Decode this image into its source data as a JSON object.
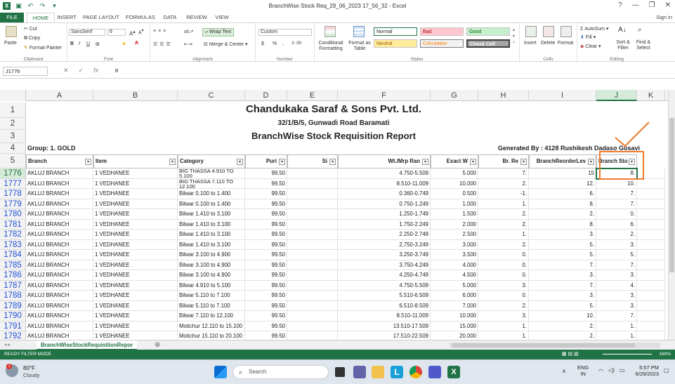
{
  "window": {
    "title": "BranchWise Stock Req_29_06_2023 17_56_32 - Excel",
    "help": "?",
    "minimize": "—",
    "restore": "❐",
    "close": "✕"
  },
  "tabs": [
    "FILE",
    "HOME",
    "INSERT",
    "PAGE LAYOUT",
    "FORMULAS",
    "DATA",
    "REVIEW",
    "VIEW"
  ],
  "signin": "Sign in",
  "ribbon": {
    "clipboard": {
      "paste": "Paste",
      "cut": "Cut",
      "copy": "Copy",
      "format_painter": "Format Painter",
      "label": "Clipboard"
    },
    "font": {
      "name": "SansSerif",
      "size": "6",
      "bold": "B",
      "italic": "I",
      "underline": "U",
      "label": "Font"
    },
    "alignment": {
      "wrap": "Wrap Text",
      "merge": "Merge & Center",
      "label": "Alignment"
    },
    "number": {
      "format": "Custom",
      "currency": "$",
      "percent": "%",
      "comma": ",",
      "label": "Number"
    },
    "styles": {
      "conditional": "Conditional Formatting",
      "format_table": "Format as Table",
      "normal": "Normal",
      "bad": "Bad",
      "good": "Good",
      "neutral": "Neutral",
      "calculation": "Calculation",
      "check_cell": "Check Cell",
      "label": "Styles"
    },
    "cells": {
      "insert": "Insert",
      "delete": "Delete",
      "format": "Format",
      "label": "Cells"
    },
    "editing": {
      "autosum": "AutoSum",
      "fill": "Fill",
      "clear": "Clear",
      "sort": "Sort & Filter",
      "find": "Find & Select",
      "label": "Editing"
    }
  },
  "formula_bar": {
    "name_box": "J1776",
    "fx": "fx",
    "cancel": "✕",
    "enter": "✓",
    "value": "8"
  },
  "columns": [
    "A",
    "B",
    "C",
    "D",
    "E",
    "F",
    "G",
    "H",
    "I",
    "J",
    "K"
  ],
  "report": {
    "company": "Chandukaka Saraf & Sons Pvt. Ltd.",
    "address": "32/1/B/5, Gunwadi Road Baramati",
    "report_title": "BranchWise Stock Requisition Report",
    "group": "Group: 1. GOLD",
    "generated_by": "Generated By : 4128 Rushikesh Dadaso Gosavi"
  },
  "headers": [
    "Branch",
    "Item",
    "Category",
    "Puri",
    "Si",
    "Wt./Mrp Ran",
    "Exact W",
    "Br. Re",
    "BranchReorderLev",
    "Branch Sto"
  ],
  "header_rows": [
    "1",
    "2",
    "3",
    "4",
    "5"
  ],
  "rows": [
    {
      "n": "1776",
      "branch": "AKLUJ BRANCH",
      "item": "1 VEDHANEE",
      "category": "BIG THASSA 4.910 TO 5.100",
      "purity": "99.50",
      "wt": "4.750-5.509",
      "exact": "5.000",
      "br": "7.",
      "reorder": "15",
      "stock": "8."
    },
    {
      "n": "1777",
      "branch": "AKLUJ BRANCH",
      "item": "1 VEDHANEE",
      "category": "BIG THASSA 7.110 TO 12.100",
      "purity": "99.50",
      "wt": "8.510-11.009",
      "exact": "10.000",
      "br": "2.",
      "reorder": "12.",
      "stock": "10."
    },
    {
      "n": "1778",
      "branch": "AKLUJ BRANCH",
      "item": "1 VEDHANEE",
      "category": "Bilwar 0.100 to 1.400",
      "purity": "99.50",
      "wt": "0.360-0.749",
      "exact": "0.500",
      "br": "-1.",
      "reorder": "6.",
      "stock": "7."
    },
    {
      "n": "1779",
      "branch": "AKLUJ BRANCH",
      "item": "1 VEDHANEE",
      "category": "Bilwar 0.100 to 1.400",
      "purity": "99.50",
      "wt": "0.750-1.249",
      "exact": "1.000",
      "br": "1.",
      "reorder": "8.",
      "stock": "7."
    },
    {
      "n": "1780",
      "branch": "AKLUJ BRANCH",
      "item": "1 VEDHANEE",
      "category": "Bilwar 1.410 to 3.100",
      "purity": "99.50",
      "wt": "1.250-1.749",
      "exact": "1.500",
      "br": "2.",
      "reorder": "2.",
      "stock": "0."
    },
    {
      "n": "1781",
      "branch": "AKLUJ BRANCH",
      "item": "1 VEDHANEE",
      "category": "Bilwar 1.410 to 3.100",
      "purity": "99.50",
      "wt": "1.750-2.249",
      "exact": "2.000",
      "br": "2.",
      "reorder": "8.",
      "stock": "6."
    },
    {
      "n": "1782",
      "branch": "AKLUJ BRANCH",
      "item": "1 VEDHANEE",
      "category": "Bilwar 1.410 to 3.100",
      "purity": "99.50",
      "wt": "2.250-2.749",
      "exact": "2.500",
      "br": "1.",
      "reorder": "3.",
      "stock": "2."
    },
    {
      "n": "1783",
      "branch": "AKLUJ BRANCH",
      "item": "1 VEDHANEE",
      "category": "Bilwar 1.410 to 3.100",
      "purity": "99.50",
      "wt": "2.750-3.249",
      "exact": "3.000",
      "br": "2.",
      "reorder": "5.",
      "stock": "3."
    },
    {
      "n": "1784",
      "branch": "AKLUJ BRANCH",
      "item": "1 VEDHANEE",
      "category": "Bilwar 3.100 to 4.900",
      "purity": "99.50",
      "wt": "3.250-3.749",
      "exact": "3.500",
      "br": "0.",
      "reorder": "5.",
      "stock": "5."
    },
    {
      "n": "1785",
      "branch": "AKLUJ BRANCH",
      "item": "1 VEDHANEE",
      "category": "Bilwar 3.100 to 4.900",
      "purity": "99.50",
      "wt": "3.750-4.249",
      "exact": "4.000",
      "br": "0.",
      "reorder": "7.",
      "stock": "7."
    },
    {
      "n": "1786",
      "branch": "AKLUJ BRANCH",
      "item": "1 VEDHANEE",
      "category": "Bilwar 3.100 to 4.900",
      "purity": "99.50",
      "wt": "4.250-4.749",
      "exact": "4.500",
      "br": "0.",
      "reorder": "3.",
      "stock": "3."
    },
    {
      "n": "1787",
      "branch": "AKLUJ BRANCH",
      "item": "1 VEDHANEE",
      "category": "Bilwar 4.910 to 5.100",
      "purity": "99.50",
      "wt": "4.750-5.509",
      "exact": "5.000",
      "br": "3.",
      "reorder": "7.",
      "stock": "4."
    },
    {
      "n": "1788",
      "branch": "AKLUJ BRANCH",
      "item": "1 VEDHANEE",
      "category": "Bilwar 5.110 to 7.100",
      "purity": "99.50",
      "wt": "5.510-6.509",
      "exact": "6.000",
      "br": "0.",
      "reorder": "3.",
      "stock": "3."
    },
    {
      "n": "1789",
      "branch": "AKLUJ BRANCH",
      "item": "1 VEDHANEE",
      "category": "Bilwar 5.110 to 7.100",
      "purity": "99.50",
      "wt": "6.510-8.509",
      "exact": "7.000",
      "br": "2.",
      "reorder": "5.",
      "stock": "3."
    },
    {
      "n": "1790",
      "branch": "AKLUJ BRANCH",
      "item": "1 VEDHANEE",
      "category": "Bilwar 7.110 to 12.100",
      "purity": "99.50",
      "wt": "8.510-11.009",
      "exact": "10.000",
      "br": "3.",
      "reorder": "10.",
      "stock": "7."
    },
    {
      "n": "1791",
      "branch": "AKLUJ BRANCH",
      "item": "1 VEDHANEE",
      "category": "Motichur 12.110 to 15.100",
      "purity": "99.50",
      "wt": "13.510-17.509",
      "exact": "15.000",
      "br": "1.",
      "reorder": "2.",
      "stock": "1."
    },
    {
      "n": "1792",
      "branch": "AKLUJ BRANCH",
      "item": "1 VEDHANEE",
      "category": "Motichur 15.110 to 20.100",
      "purity": "99.50",
      "wt": "17.510-22.509",
      "exact": "20.000",
      "br": "1.",
      "reorder": "2.",
      "stock": "1."
    }
  ],
  "sheet": {
    "name": "BranchWiseStockRequisitionRepor",
    "add": "⊕"
  },
  "status": {
    "left": "READY   FILTER MODE",
    "zoom": "160%"
  },
  "taskbar": {
    "weather_temp": "80°F",
    "weather_desc": "Cloudy",
    "search": "Search",
    "lang": "ENG",
    "region": "IN",
    "time": "5:57 PM",
    "date": "6/29/2023"
  },
  "colors": {
    "excel_green": "#217346",
    "annotation": "#ef7a2c",
    "row_blue": "#1f4fd6"
  }
}
